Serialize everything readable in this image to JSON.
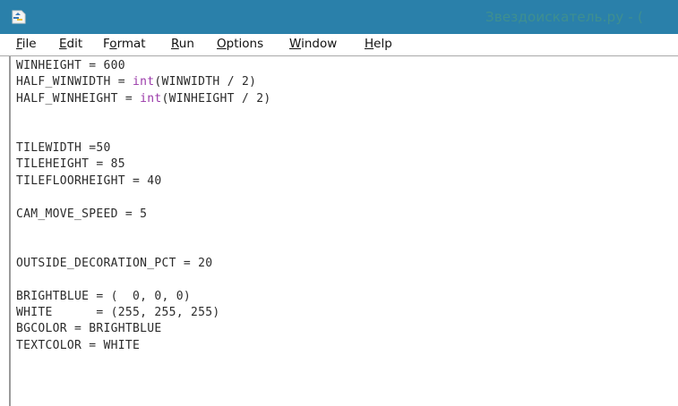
{
  "window": {
    "title": "Звездоискатель.ру - ("
  },
  "menu": [
    {
      "label": "File",
      "accel_index": 0
    },
    {
      "label": "Edit",
      "accel_index": 0
    },
    {
      "label": "Format",
      "accel_index": 1
    },
    {
      "label": "Run",
      "accel_index": 0
    },
    {
      "label": "Options",
      "accel_index": 0
    },
    {
      "label": "Window",
      "accel_index": 0
    },
    {
      "label": "Help",
      "accel_index": 0
    }
  ],
  "code_lines": [
    [
      {
        "t": "WINHEIGHT = 600"
      }
    ],
    [
      {
        "t": "HALF_WINWIDTH = "
      },
      {
        "t": "int",
        "kw": true
      },
      {
        "t": "(WINWIDTH / 2)"
      }
    ],
    [
      {
        "t": "HALF_WINHEIGHT = "
      },
      {
        "t": "int",
        "kw": true
      },
      {
        "t": "(WINHEIGHT / 2)"
      }
    ],
    [],
    [],
    [
      {
        "t": "TILEWIDTH =50"
      }
    ],
    [
      {
        "t": "TILEHEIGHT = 85"
      }
    ],
    [
      {
        "t": "TILEFLOORHEIGHT = 40"
      }
    ],
    [],
    [
      {
        "t": "CAM_MOVE_SPEED = 5"
      }
    ],
    [],
    [],
    [
      {
        "t": "OUTSIDE_DECORATION_PCT = 20"
      }
    ],
    [],
    [
      {
        "t": "BRIGHTBLUE = (  0, 0, 0)"
      }
    ],
    [
      {
        "t": "WHITE      = (255, 255, 255)"
      }
    ],
    [
      {
        "t": "BGCOLOR = BRIGHTBLUE"
      }
    ],
    [
      {
        "t": "TEXTCOLOR = WHITE"
      }
    ]
  ],
  "colors": {
    "titlebar": "#2a80aa",
    "title_text": "#3f8f8f",
    "keyword": "#9a39a9",
    "code_text": "#2b2b2b"
  },
  "icons": {
    "app": "python-idle-icon"
  }
}
